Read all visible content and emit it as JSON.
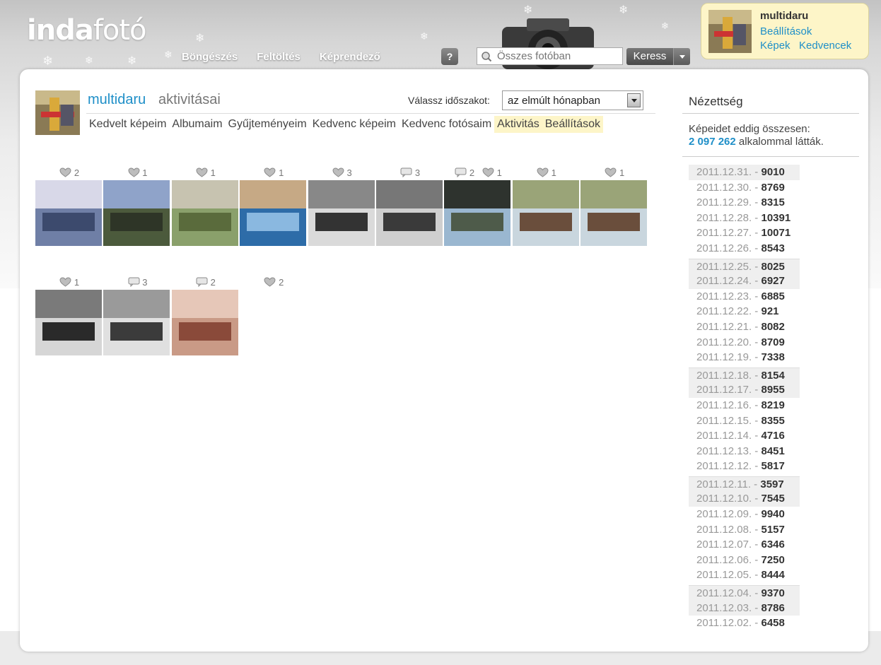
{
  "brand": {
    "part1": "inda",
    "part2": "fotó"
  },
  "nav": [
    "Böngészés",
    "Feltöltés",
    "Képrendező"
  ],
  "help_label": "?",
  "search": {
    "placeholder": "Összes fotóban",
    "button": "Keress"
  },
  "user_box": {
    "name": "multidaru",
    "settings": "Beállítások",
    "pictures": "Képek",
    "favorites": "Kedvencek"
  },
  "profile": {
    "name": "multidaru",
    "subtitle": "aktivitásai",
    "period_label": "Válassz időszakot:",
    "period_value": "az elmúlt hónapban",
    "tabs": [
      "Kedvelt képeim",
      "Albumaim",
      "Gyűjteményeim",
      "Kedvenc képeim",
      "Kedvenc fotósaim",
      "Aktivitás",
      "Beállítások"
    ]
  },
  "photos_row1": [
    {
      "likes": "2",
      "comments": "",
      "colors": [
        "#6f7fa6",
        "#3c4a6d",
        "#d8d8e8"
      ]
    },
    {
      "likes": "1",
      "comments": "",
      "colors": [
        "#4c5a3c",
        "#2e3527",
        "#8fa3c9"
      ]
    },
    {
      "likes": "1",
      "comments": "",
      "colors": [
        "#8aa06b",
        "#5a6b3c",
        "#c7c3b0"
      ]
    },
    {
      "likes": "1",
      "comments": "",
      "colors": [
        "#2e6ca8",
        "#8ab8e0",
        "#c6a985"
      ]
    },
    {
      "likes": "3",
      "comments": "",
      "colors": [
        "#dadada",
        "#333333",
        "#888888"
      ]
    },
    {
      "likes": "",
      "comments": "3",
      "colors": [
        "#cfcfcf",
        "#3a3a3a",
        "#777777"
      ]
    },
    {
      "likes": "1",
      "comments": "2",
      "colors": [
        "#9ab7d0",
        "#4e5b4a",
        "#2e332e"
      ]
    },
    {
      "likes": "1",
      "comments": "",
      "colors": [
        "#c9d6de",
        "#6a4e3c",
        "#9aa478"
      ]
    },
    {
      "likes": "1",
      "comments": "",
      "colors": [
        "#c9d6de",
        "#6a4e3c",
        "#9aa478"
      ]
    }
  ],
  "photos_row2": [
    {
      "likes": "1",
      "comments": "",
      "colors": [
        "#d6d6d6",
        "#2a2a2a",
        "#7a7a7a"
      ]
    },
    {
      "likes": "",
      "comments": "3",
      "colors": [
        "#e0e0e0",
        "#3b3b3b",
        "#9a9a9a"
      ]
    },
    {
      "likes": "",
      "comments": "2",
      "colors": [
        "#c99a86",
        "#8a4a3a",
        "#e6c7b8"
      ]
    },
    {
      "likes": "2",
      "comments": "",
      "colors": null
    }
  ],
  "side": {
    "title": "Nézettség",
    "desc_prefix": "Képeidet eddig összesen:",
    "total": "2 097 262",
    "desc_suffix": " alkalommal látták.",
    "days": [
      {
        "d": "2011.12.31.",
        "v": "9010",
        "shade": true,
        "week": false
      },
      {
        "d": "2011.12.30.",
        "v": "8769",
        "shade": false,
        "week": false
      },
      {
        "d": "2011.12.29.",
        "v": "8315",
        "shade": false,
        "week": false
      },
      {
        "d": "2011.12.28.",
        "v": "10391",
        "shade": false,
        "week": false
      },
      {
        "d": "2011.12.27.",
        "v": "10071",
        "shade": false,
        "week": false
      },
      {
        "d": "2011.12.26.",
        "v": "8543",
        "shade": false,
        "week": false
      },
      {
        "d": "2011.12.25.",
        "v": "8025",
        "shade": true,
        "week": true
      },
      {
        "d": "2011.12.24.",
        "v": "6927",
        "shade": true,
        "week": false
      },
      {
        "d": "2011.12.23.",
        "v": "6885",
        "shade": false,
        "week": false
      },
      {
        "d": "2011.12.22.",
        "v": "921",
        "shade": false,
        "week": false
      },
      {
        "d": "2011.12.21.",
        "v": "8082",
        "shade": false,
        "week": false
      },
      {
        "d": "2011.12.20.",
        "v": "8709",
        "shade": false,
        "week": false
      },
      {
        "d": "2011.12.19.",
        "v": "7338",
        "shade": false,
        "week": false
      },
      {
        "d": "2011.12.18.",
        "v": "8154",
        "shade": true,
        "week": true
      },
      {
        "d": "2011.12.17.",
        "v": "8955",
        "shade": true,
        "week": false
      },
      {
        "d": "2011.12.16.",
        "v": "8219",
        "shade": false,
        "week": false
      },
      {
        "d": "2011.12.15.",
        "v": "8355",
        "shade": false,
        "week": false
      },
      {
        "d": "2011.12.14.",
        "v": "4716",
        "shade": false,
        "week": false
      },
      {
        "d": "2011.12.13.",
        "v": "8451",
        "shade": false,
        "week": false
      },
      {
        "d": "2011.12.12.",
        "v": "5817",
        "shade": false,
        "week": false
      },
      {
        "d": "2011.12.11.",
        "v": "3597",
        "shade": true,
        "week": true
      },
      {
        "d": "2011.12.10.",
        "v": "7545",
        "shade": true,
        "week": false
      },
      {
        "d": "2011.12.09.",
        "v": "9940",
        "shade": false,
        "week": false
      },
      {
        "d": "2011.12.08.",
        "v": "5157",
        "shade": false,
        "week": false
      },
      {
        "d": "2011.12.07.",
        "v": "6346",
        "shade": false,
        "week": false
      },
      {
        "d": "2011.12.06.",
        "v": "7250",
        "shade": false,
        "week": false
      },
      {
        "d": "2011.12.05.",
        "v": "8444",
        "shade": false,
        "week": false
      },
      {
        "d": "2011.12.04.",
        "v": "9370",
        "shade": true,
        "week": true
      },
      {
        "d": "2011.12.03.",
        "v": "8786",
        "shade": true,
        "week": false
      },
      {
        "d": "2011.12.02.",
        "v": "6458",
        "shade": false,
        "week": false
      }
    ]
  },
  "colors": {
    "accent": "#1f8fc8",
    "highlight": "#fdf5c8"
  }
}
